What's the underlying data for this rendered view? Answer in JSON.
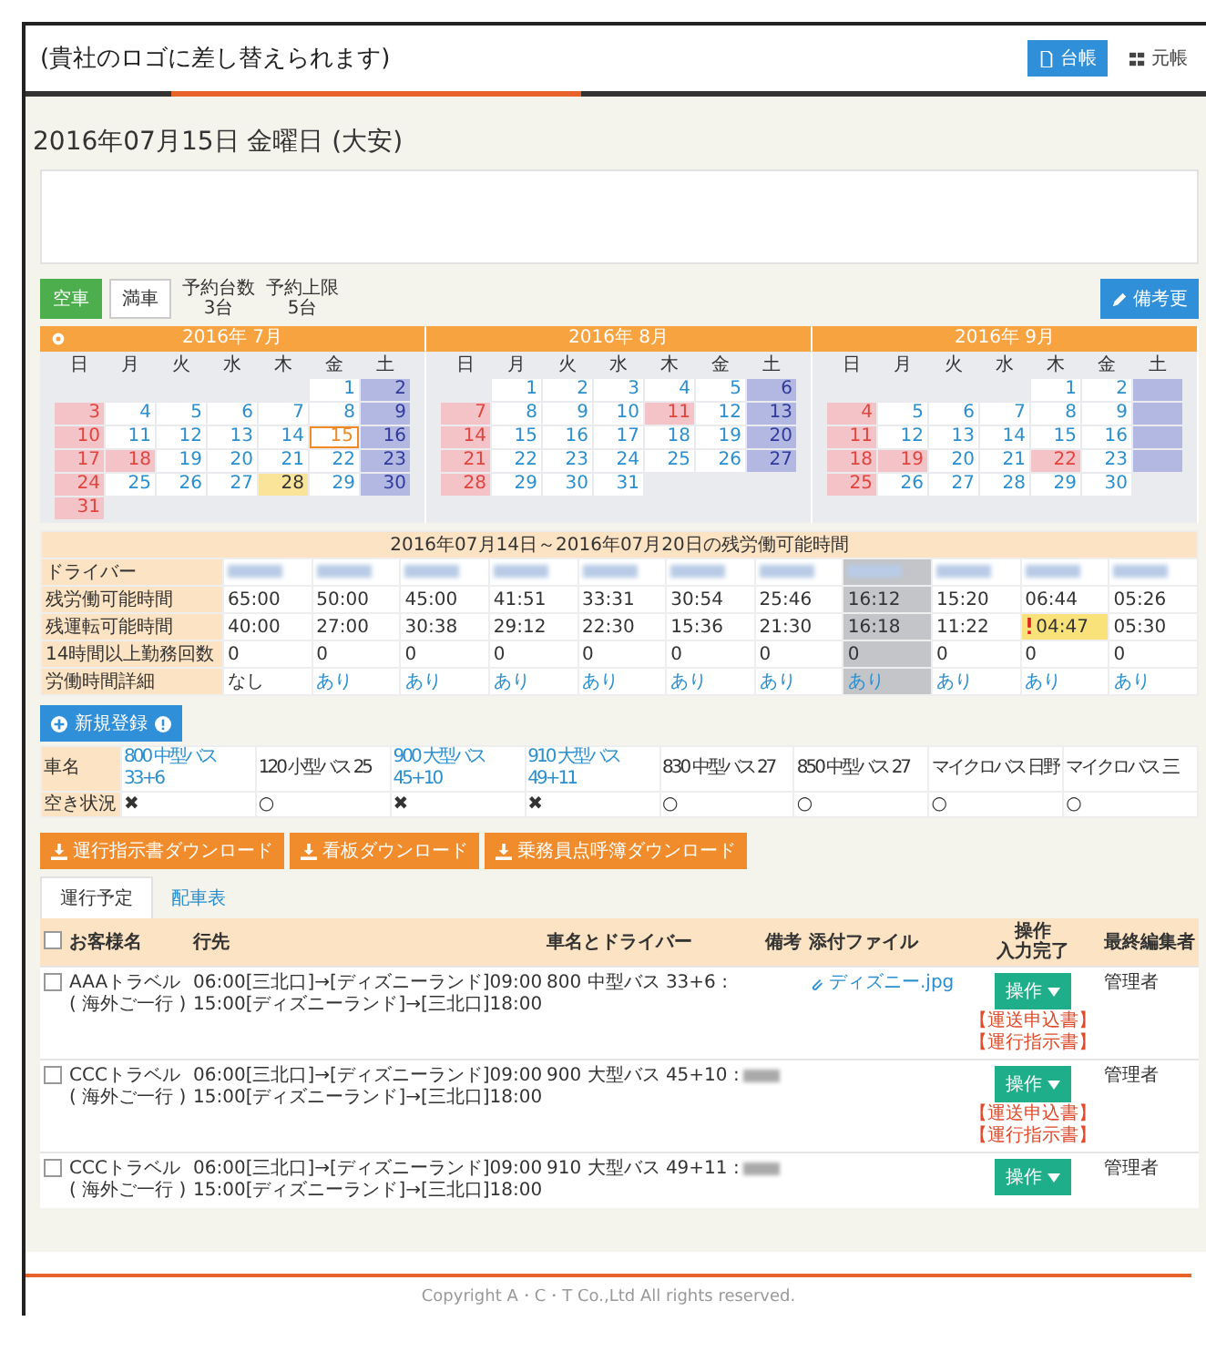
{
  "header": {
    "logo": "(貴社のロゴに差し替えられます)",
    "nav": [
      {
        "label": "台帳",
        "selected": true
      },
      {
        "label": "元帳",
        "selected": false
      }
    ]
  },
  "date_title": "2016年07月15日  金曜日 (大安)",
  "toolbar": {
    "buttons": [
      {
        "label": "空車",
        "selected": true
      },
      {
        "label": "満車",
        "selected": false
      }
    ],
    "stats": [
      {
        "label": "予約台数",
        "value": "3台"
      },
      {
        "label": "予約上限",
        "value": "5台"
      }
    ],
    "note_button": "備考更"
  },
  "calendar": {
    "months": [
      {
        "title": "2016年 7月",
        "weekdays": [
          "日",
          "月",
          "火",
          "水",
          "木",
          "金",
          "土"
        ],
        "weeks": [
          [
            {
              "kind": "blank"
            },
            {
              "kind": "blank"
            },
            {
              "kind": "blank"
            },
            {
              "kind": "blank"
            },
            {
              "kind": "blank"
            },
            {
              "day": "1",
              "kind": "weekday"
            },
            {
              "day": "2",
              "kind": "saturday"
            }
          ],
          [
            {
              "day": "3",
              "kind": "sunday"
            },
            {
              "day": "4",
              "kind": "weekday"
            },
            {
              "day": "5",
              "kind": "weekday"
            },
            {
              "day": "6",
              "kind": "weekday"
            },
            {
              "day": "7",
              "kind": "weekday"
            },
            {
              "day": "8",
              "kind": "weekday"
            },
            {
              "day": "9",
              "kind": "saturday"
            }
          ],
          [
            {
              "day": "10",
              "kind": "sunday"
            },
            {
              "day": "11",
              "kind": "weekday"
            },
            {
              "day": "12",
              "kind": "weekday"
            },
            {
              "day": "13",
              "kind": "weekday"
            },
            {
              "day": "14",
              "kind": "weekday"
            },
            {
              "day": "15",
              "kind": "today"
            },
            {
              "day": "16",
              "kind": "saturday"
            }
          ],
          [
            {
              "day": "17",
              "kind": "sunday"
            },
            {
              "day": "18",
              "kind": "holiday"
            },
            {
              "day": "19",
              "kind": "weekday"
            },
            {
              "day": "20",
              "kind": "weekday"
            },
            {
              "day": "21",
              "kind": "weekday"
            },
            {
              "day": "22",
              "kind": "weekday"
            },
            {
              "day": "23",
              "kind": "saturday"
            }
          ],
          [
            {
              "day": "24",
              "kind": "sunday"
            },
            {
              "day": "25",
              "kind": "weekday"
            },
            {
              "day": "26",
              "kind": "weekday"
            },
            {
              "day": "27",
              "kind": "weekday"
            },
            {
              "day": "28",
              "kind": "marked"
            },
            {
              "day": "29",
              "kind": "weekday"
            },
            {
              "day": "30",
              "kind": "saturday"
            }
          ],
          [
            {
              "day": "31",
              "kind": "sunday"
            }
          ]
        ]
      },
      {
        "title": "2016年 8月",
        "weekdays": [
          "日",
          "月",
          "火",
          "水",
          "木",
          "金",
          "土"
        ],
        "weeks": [
          [
            {
              "kind": "blank"
            },
            {
              "day": "1",
              "kind": "weekday"
            },
            {
              "day": "2",
              "kind": "weekday"
            },
            {
              "day": "3",
              "kind": "weekday"
            },
            {
              "day": "4",
              "kind": "weekday"
            },
            {
              "day": "5",
              "kind": "weekday"
            },
            {
              "day": "6",
              "kind": "saturday"
            }
          ],
          [
            {
              "day": "7",
              "kind": "sunday"
            },
            {
              "day": "8",
              "kind": "weekday"
            },
            {
              "day": "9",
              "kind": "weekday"
            },
            {
              "day": "10",
              "kind": "weekday"
            },
            {
              "day": "11",
              "kind": "holiday"
            },
            {
              "day": "12",
              "kind": "weekday"
            },
            {
              "day": "13",
              "kind": "saturday"
            }
          ],
          [
            {
              "day": "14",
              "kind": "sunday"
            },
            {
              "day": "15",
              "kind": "weekday"
            },
            {
              "day": "16",
              "kind": "weekday"
            },
            {
              "day": "17",
              "kind": "weekday"
            },
            {
              "day": "18",
              "kind": "weekday"
            },
            {
              "day": "19",
              "kind": "weekday"
            },
            {
              "day": "20",
              "kind": "saturday"
            }
          ],
          [
            {
              "day": "21",
              "kind": "sunday"
            },
            {
              "day": "22",
              "kind": "weekday"
            },
            {
              "day": "23",
              "kind": "weekday"
            },
            {
              "day": "24",
              "kind": "weekday"
            },
            {
              "day": "25",
              "kind": "weekday"
            },
            {
              "day": "26",
              "kind": "weekday"
            },
            {
              "day": "27",
              "kind": "saturday"
            }
          ],
          [
            {
              "day": "28",
              "kind": "sunday"
            },
            {
              "day": "29",
              "kind": "weekday"
            },
            {
              "day": "30",
              "kind": "weekday"
            },
            {
              "day": "31",
              "kind": "weekday"
            }
          ]
        ]
      },
      {
        "title": "2016年 9月",
        "weekdays": [
          "日",
          "月",
          "火",
          "水",
          "木",
          "金",
          "土"
        ],
        "weeks": [
          [
            {
              "kind": "blank"
            },
            {
              "kind": "blank"
            },
            {
              "kind": "blank"
            },
            {
              "kind": "blank"
            },
            {
              "day": "1",
              "kind": "weekday"
            },
            {
              "day": "2",
              "kind": "weekday"
            },
            {
              "kind": "saturday"
            }
          ],
          [
            {
              "day": "4",
              "kind": "sunday"
            },
            {
              "day": "5",
              "kind": "weekday"
            },
            {
              "day": "6",
              "kind": "weekday"
            },
            {
              "day": "7",
              "kind": "weekday"
            },
            {
              "day": "8",
              "kind": "weekday"
            },
            {
              "day": "9",
              "kind": "weekday"
            },
            {
              "kind": "saturday"
            }
          ],
          [
            {
              "day": "11",
              "kind": "sunday"
            },
            {
              "day": "12",
              "kind": "weekday"
            },
            {
              "day": "13",
              "kind": "weekday"
            },
            {
              "day": "14",
              "kind": "weekday"
            },
            {
              "day": "15",
              "kind": "weekday"
            },
            {
              "day": "16",
              "kind": "weekday"
            },
            {
              "kind": "saturday"
            }
          ],
          [
            {
              "day": "18",
              "kind": "sunday"
            },
            {
              "day": "19",
              "kind": "holiday"
            },
            {
              "day": "20",
              "kind": "weekday"
            },
            {
              "day": "21",
              "kind": "weekday"
            },
            {
              "day": "22",
              "kind": "holiday"
            },
            {
              "day": "23",
              "kind": "weekday"
            },
            {
              "kind": "saturday"
            }
          ],
          [
            {
              "day": "25",
              "kind": "sunday"
            },
            {
              "day": "26",
              "kind": "weekday"
            },
            {
              "day": "27",
              "kind": "weekday"
            },
            {
              "day": "28",
              "kind": "weekday"
            },
            {
              "day": "29",
              "kind": "weekday"
            },
            {
              "day": "30",
              "kind": "weekday"
            }
          ]
        ]
      }
    ]
  },
  "driver_table": {
    "title": "2016年07月14日～2016年07月20日の残労働可能時間",
    "row_labels": [
      "ドライバー",
      "残労働可能時間",
      "残運転可能時間",
      "14時間以上勤務回数",
      "労働時間詳細"
    ],
    "drivers": [
      {
        "selected": false,
        "work": "65:00",
        "drive": "40:00",
        "warning": false,
        "over14": "0",
        "detail": "なし",
        "detail_link": false
      },
      {
        "selected": false,
        "work": "50:00",
        "drive": "27:00",
        "warning": false,
        "over14": "0",
        "detail": "あり",
        "detail_link": true
      },
      {
        "selected": false,
        "work": "45:00",
        "drive": "30:38",
        "warning": false,
        "over14": "0",
        "detail": "あり",
        "detail_link": true
      },
      {
        "selected": false,
        "work": "41:51",
        "drive": "29:12",
        "warning": false,
        "over14": "0",
        "detail": "あり",
        "detail_link": true
      },
      {
        "selected": false,
        "work": "33:31",
        "drive": "22:30",
        "warning": false,
        "over14": "0",
        "detail": "あり",
        "detail_link": true
      },
      {
        "selected": false,
        "work": "30:54",
        "drive": "15:36",
        "warning": false,
        "over14": "0",
        "detail": "あり",
        "detail_link": true
      },
      {
        "selected": false,
        "work": "25:46",
        "drive": "21:30",
        "warning": false,
        "over14": "0",
        "detail": "あり",
        "detail_link": true
      },
      {
        "selected": true,
        "work": "16:12",
        "drive": "16:18",
        "warning": false,
        "over14": "0",
        "detail": "あり",
        "detail_link": true
      },
      {
        "selected": false,
        "work": "15:20",
        "drive": "11:22",
        "warning": false,
        "over14": "0",
        "detail": "あり",
        "detail_link": true
      },
      {
        "selected": false,
        "work": "06:44",
        "drive": "04:47",
        "warning": true,
        "over14": "0",
        "detail": "あり",
        "detail_link": true
      },
      {
        "selected": false,
        "work": "05:26",
        "drive": "05:30",
        "warning": false,
        "over14": "0",
        "detail": "あり",
        "detail_link": true
      }
    ]
  },
  "register_button": "新規登録",
  "vehicle_table": {
    "row_labels": [
      "車名",
      "空き状況"
    ],
    "vehicles": [
      {
        "name": "800 中型バス 33+6",
        "link": true,
        "status": "✖"
      },
      {
        "name": "120 小型バス 25",
        "link": false,
        "status": "○"
      },
      {
        "name": "900 大型バス 45+10",
        "link": true,
        "status": "✖"
      },
      {
        "name": "910 大型バス 49+11",
        "link": true,
        "status": "✖"
      },
      {
        "name": "830 中型バス 27",
        "link": false,
        "status": "○"
      },
      {
        "name": "850 中型バス 27",
        "link": false,
        "status": "○"
      },
      {
        "name": "マイクロバス 日野",
        "link": false,
        "status": "○"
      },
      {
        "name": "マイクロバス 三",
        "link": false,
        "status": "○"
      }
    ]
  },
  "downloads": [
    "運行指示書ダウンロード",
    "看板ダウンロード",
    "乗務員点呼簿ダウンロード"
  ],
  "tabs": [
    {
      "label": "運行予定",
      "selected": true
    },
    {
      "label": "配車表",
      "selected": false
    }
  ],
  "schedule": {
    "all_checked": false,
    "columns": [
      [
        "お客様名"
      ],
      [
        "行先"
      ],
      [
        "車名とドライバー"
      ],
      [
        "備考"
      ],
      [
        "添付ファイル"
      ],
      [
        "操作",
        "入力完了"
      ],
      [
        "最終編集者"
      ]
    ],
    "rows": [
      {
        "checked": false,
        "customer": [
          "AAAトラベル",
          "( 海外ご一行 )"
        ],
        "route": [
          "06:00[三北口]→[ディズニーランド]09:00",
          "15:00[ディズニーランド]→[三北口]18:00"
        ],
        "vehicle": "800 中型バス 33+6 :",
        "driver_hidden": false,
        "file": "ディズニー.jpg",
        "action": "操作",
        "documents": [
          "【運送申込書】",
          "【運行指示書】"
        ],
        "editor": "管理者"
      },
      {
        "checked": false,
        "customer": [
          "CCCトラベル",
          "( 海外ご一行 )"
        ],
        "route": [
          "06:00[三北口]→[ディズニーランド]09:00",
          "15:00[ディズニーランド]→[三北口]18:00"
        ],
        "vehicle": "900 大型バス 45+10 :",
        "driver_hidden": true,
        "action": "操作",
        "documents": [
          "【運送申込書】",
          "【運行指示書】"
        ],
        "editor": "管理者"
      },
      {
        "checked": false,
        "customer": [
          "CCCトラベル",
          "( 海外ご一行 )"
        ],
        "route": [
          "06:00[三北口]→[ディズニーランド]09:00",
          "15:00[ディズニーランド]→[三北口]18:00"
        ],
        "vehicle": "910 大型バス 49+11 :",
        "driver_hidden": true,
        "action": "操作",
        "editor": "管理者"
      }
    ]
  },
  "footer": "Copyright A・C・T Co.,Ltd All rights reserved."
}
